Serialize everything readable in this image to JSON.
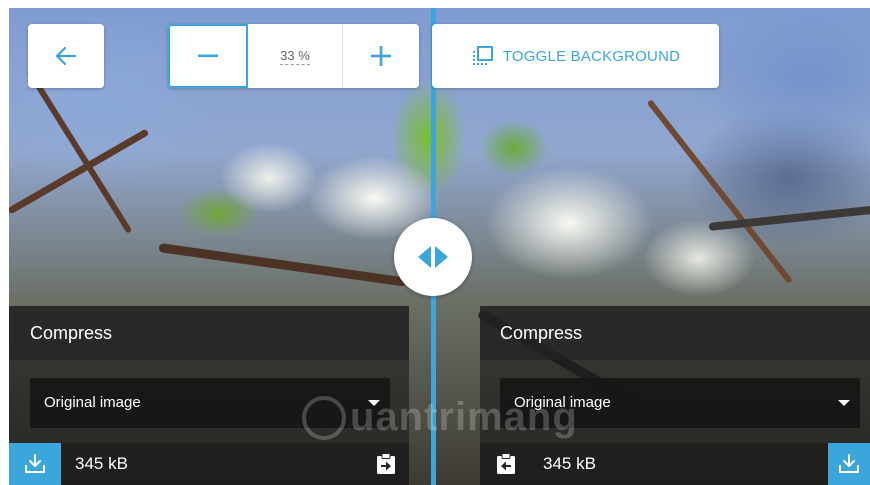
{
  "toolbar": {
    "back_icon": "arrow-left-icon",
    "zoom_out_icon": "minus-icon",
    "zoom_in_icon": "plus-icon",
    "zoom_value": "33 %",
    "toggle_background_label": "TOGGLE BACKGROUND",
    "toggle_background_icon": "dotted-square-icon"
  },
  "compare": {
    "handle_icon": "split-arrows-icon"
  },
  "left_panel": {
    "title": "Compress",
    "method": "Original image",
    "size": "345 kB",
    "download_icon": "download-icon",
    "clipboard_icon": "paste-right-icon"
  },
  "right_panel": {
    "title": "Compress",
    "method": "Original image",
    "size": "345 kB",
    "download_icon": "download-icon",
    "clipboard_icon": "paste-left-icon"
  },
  "watermark": "uantrimang",
  "colors": {
    "accent": "#3aa6dc",
    "panel": "#202020",
    "text": "#ffffff"
  }
}
